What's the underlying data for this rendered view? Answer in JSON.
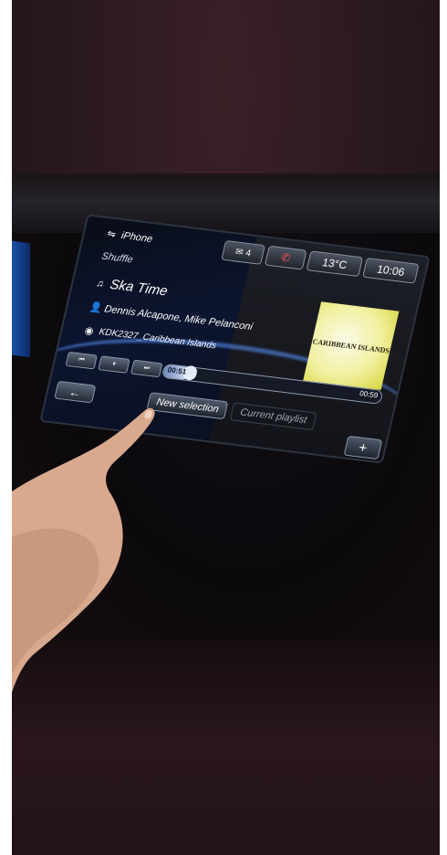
{
  "screen": {
    "source": "iPhone",
    "mode": "Shuffle",
    "track": "Ska Time",
    "artist": "Dennis Alcapone, Mike Pelanconi",
    "album_file": "KDK2327_Caribbean Islands",
    "messages": "4",
    "temperature": "13°C",
    "clock": "10:06",
    "album_art_text": "CARIBBEAN ISLANDS",
    "elapsed": "00:51",
    "total": "00:59",
    "progress_fraction": 0.12,
    "new_selection": "New selection",
    "current_playlist": "Current playlist",
    "plus": "+",
    "back": "←",
    "controls": [
      "⏮",
      "⏸",
      "⏭"
    ]
  }
}
